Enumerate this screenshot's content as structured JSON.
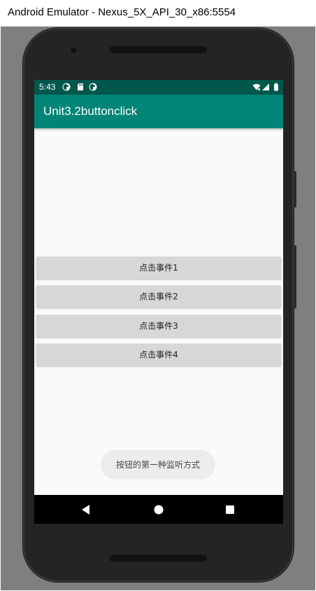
{
  "window": {
    "title": "Android Emulator - Nexus_5X_API_30_x86:5554"
  },
  "status_bar": {
    "time": "5:43",
    "background": "#00574b",
    "left_icons": [
      "sync-icon",
      "sd-card-icon",
      "sync-icon"
    ],
    "right_icons": [
      "wifi-icon",
      "cell-signal-icon",
      "battery-icon"
    ]
  },
  "app_bar": {
    "title": "Unit3.2buttonclick",
    "background": "#008577"
  },
  "buttons": [
    {
      "label": "点击事件1"
    },
    {
      "label": "点击事件2"
    },
    {
      "label": "点击事件3"
    },
    {
      "label": "点击事件4"
    }
  ],
  "toast": {
    "text": "按钮的第一种监听方式"
  },
  "nav_bar": {
    "icons": [
      "back-triangle-icon",
      "home-circle-icon",
      "recents-square-icon"
    ]
  }
}
